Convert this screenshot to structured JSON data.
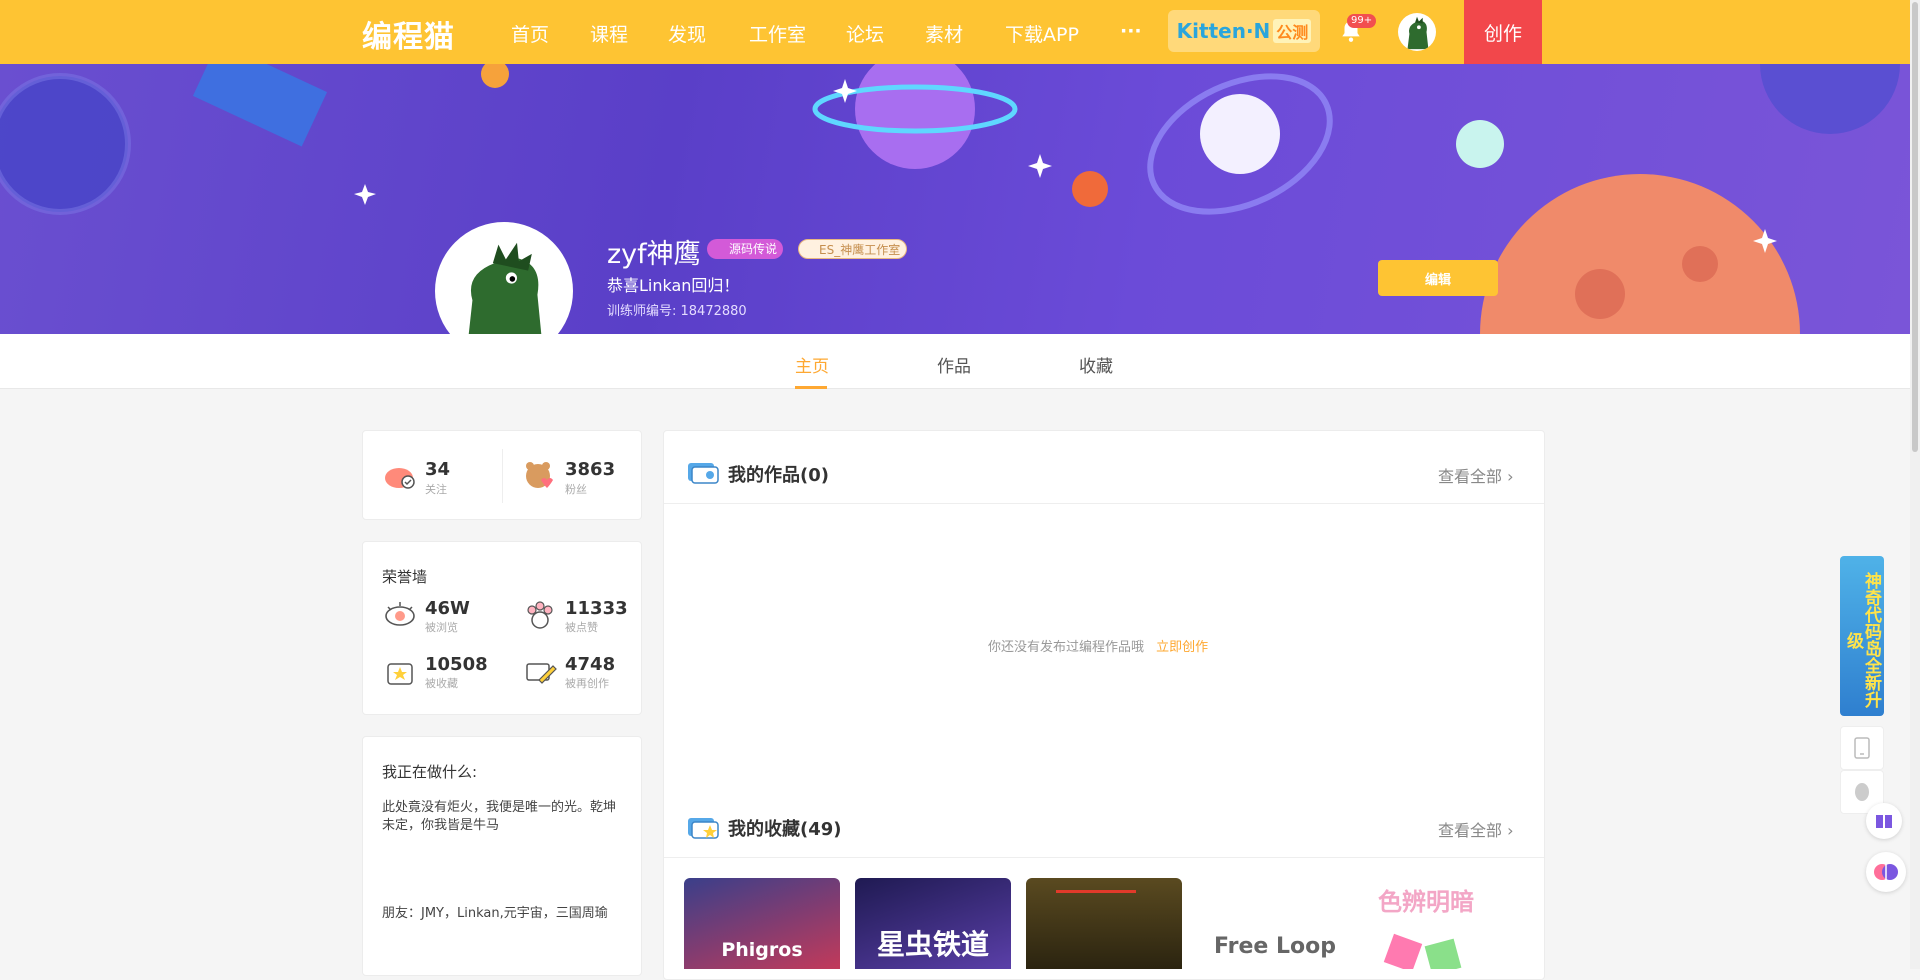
{
  "nav": {
    "logo": "编程猫",
    "items": [
      "首页",
      "课程",
      "发现",
      "工作室",
      "论坛",
      "素材",
      "下载APP"
    ],
    "more": "···",
    "kitten_label": "Kitten·N",
    "kitten_badge": "公测",
    "notif_count": "99+",
    "create": "创作"
  },
  "profile": {
    "name": "zyf神鹰",
    "tag_level": "源码传说",
    "tag_studio": "ES_神鹰工作室",
    "motto": "恭喜Linkan回归！",
    "uid": "训练师编号: 18472880",
    "edit": "编辑"
  },
  "tabs": [
    "主页",
    "作品",
    "收藏"
  ],
  "follow": {
    "following_num": "34",
    "following_label": "关注",
    "fans_num": "3863",
    "fans_label": "粉丝"
  },
  "honor": {
    "title": "荣誉墙",
    "stats": [
      {
        "num": "46W",
        "label": "被浏览",
        "icon": "eye-icon"
      },
      {
        "num": "11333",
        "label": "被点赞",
        "icon": "paw-icon"
      },
      {
        "num": "10508",
        "label": "被收藏",
        "icon": "star-box-icon"
      },
      {
        "num": "4748",
        "label": "被再创作",
        "icon": "pencil-icon"
      }
    ]
  },
  "doing": {
    "title": "我正在做什么:",
    "text1": "此处竟没有炬火，我便是唯一的光。乾坤未定，你我皆是牛马",
    "text2": "朋友：JMY，Linkan,元宇宙，三国周瑜"
  },
  "works": {
    "title": "我的作品(0)",
    "see_all": "查看全部",
    "empty": "你还没有发布过编程作品哦",
    "empty_link": "立即创作"
  },
  "collect": {
    "title": "我的收藏(49)",
    "see_all": "查看全部",
    "thumbs": [
      "Phigros",
      "星虫铁道",
      "",
      "Free Loop",
      "色辨明暗"
    ]
  },
  "side": {
    "ad": "神奇代码岛全新升级"
  },
  "colors": {
    "brand": "#fec433",
    "create_red": "#f2474b",
    "accent_orange": "#fea832"
  }
}
